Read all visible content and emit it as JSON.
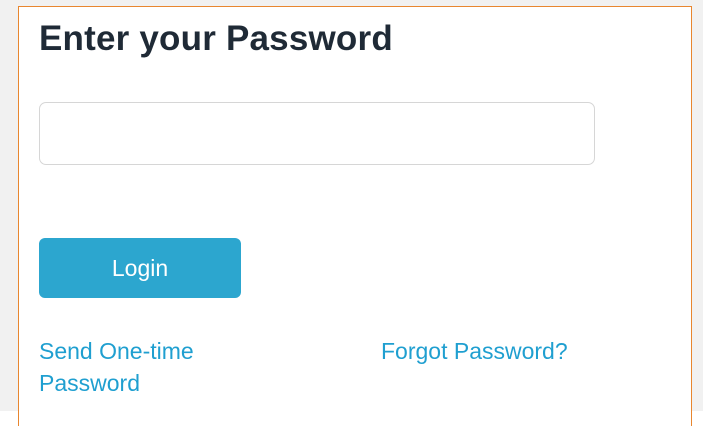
{
  "form": {
    "title": "Enter your Password",
    "password": {
      "value": "",
      "placeholder": ""
    },
    "login_label": "Login",
    "send_otp_label": "Send One-time Password",
    "forgot_label": "Forgot Password?"
  },
  "colors": {
    "accent_border": "#e8862f",
    "button_bg": "#2ca6cf",
    "link": "#1f9fd0",
    "title": "#1f2a36"
  }
}
